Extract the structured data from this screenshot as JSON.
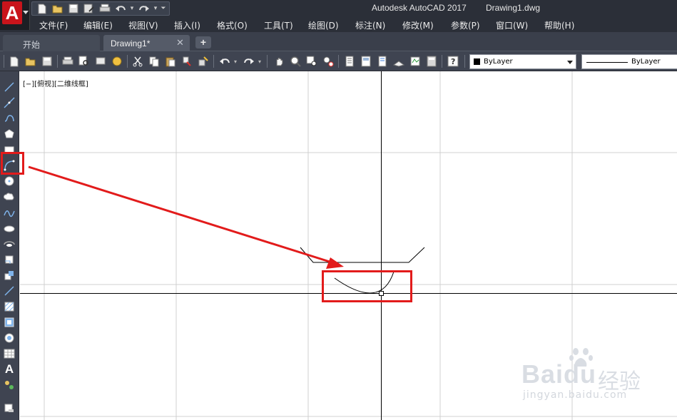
{
  "window": {
    "app_title": "Autodesk AutoCAD 2017",
    "doc_title": "Drawing1.dwg"
  },
  "quick_access": [
    "new-icon",
    "open-icon",
    "save-icon",
    "save-as-icon",
    "print-icon",
    "undo-icon",
    "redo-icon",
    "customize-icon"
  ],
  "menu": {
    "items": [
      "文件(F)",
      "编辑(E)",
      "视图(V)",
      "插入(I)",
      "格式(O)",
      "工具(T)",
      "绘图(D)",
      "标注(N)",
      "修改(M)",
      "参数(P)",
      "窗口(W)",
      "帮助(H)"
    ]
  },
  "tabs": {
    "start": "开始",
    "drawing": "Drawing1*",
    "close_glyph": "✕",
    "add_glyph": "+"
  },
  "toolbar": {
    "layer_value": "ByLayer",
    "linetype_value": "ByLayer"
  },
  "left_toolbar": [
    "line-icon",
    "construction-line-icon",
    "polyline-icon",
    "polygon-icon",
    "rectangle-icon",
    "arc-icon",
    "circle-icon",
    "revision-cloud-icon",
    "spline-icon",
    "ellipse-icon",
    "ellipse-arc-icon",
    "insert-block-icon",
    "make-block-icon",
    "point-icon",
    "hatch-icon",
    "gradient-icon",
    "region-icon",
    "table-icon",
    "multiline-text-icon",
    "add-selected-icon",
    "layer-states-icon"
  ],
  "canvas": {
    "viewport_label": "[−][俯视][二维线框]"
  },
  "watermark": {
    "brand": "Baidu",
    "brand_cn": "经验",
    "url": "jingyan.baidu.com"
  },
  "colors": {
    "annotation_red": "#e21b1b",
    "autocad_red": "#c9141b",
    "dark_chrome": "#2b2f38"
  }
}
